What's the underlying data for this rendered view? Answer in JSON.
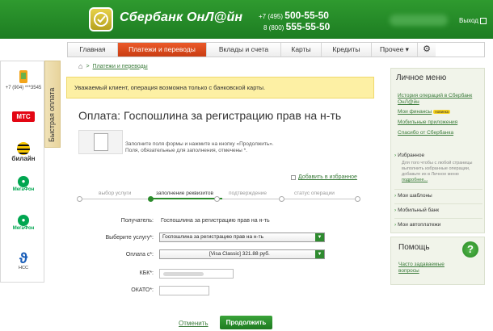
{
  "header": {
    "logo_text": "Сбербанк ОнЛ@йн",
    "phone1_prefix": "+7 (495)",
    "phone1_number": "500-55-50",
    "phone2_prefix": "8 (800)",
    "phone2_number": "555-55-50",
    "exit_label": "Выход"
  },
  "nav": {
    "items": [
      {
        "label": "Главная"
      },
      {
        "label": "Платежи и переводы"
      },
      {
        "label": "Вклады и счета"
      },
      {
        "label": "Карты"
      },
      {
        "label": "Кредиты"
      },
      {
        "label": "Прочее ▾"
      }
    ],
    "settings_icon": "gear-icon"
  },
  "quick_pay": {
    "tab_label": "Быстрая оплата",
    "operators": [
      {
        "name": "",
        "number": "+7 (904) ***3545"
      },
      {
        "name": "МТС"
      },
      {
        "name": "билайн"
      },
      {
        "name": "МегаФон"
      },
      {
        "name": "МегаФон"
      },
      {
        "name": "НСС"
      }
    ]
  },
  "breadcrumb": {
    "link": "Платежи и переводы"
  },
  "alert": "Уважаемый клиент, операция возможна только с банковской карты.",
  "page_title": "Оплата: Госпошлина за регистрацию прав на н-ть",
  "hint": {
    "line1": "Заполните поля формы и нажмите на кнопку «Продолжить».",
    "line2": "Поля, обязательные для заполнения, отмечены *."
  },
  "favorite_link": "Добавить в избранное",
  "steps": [
    {
      "label": "выбор услуги"
    },
    {
      "label": "заполнение реквизитов"
    },
    {
      "label": "подтверждение"
    },
    {
      "label": "статус операции"
    }
  ],
  "form": {
    "recipient_label": "Получатель:",
    "recipient_value": "Госпошлина за регистрацию прав на н-ть",
    "service_label": "Выберите услугу*:",
    "service_value": "Госпошлина за регистрацию прав на н-ть",
    "payfrom_label": "Оплата с*:",
    "payfrom_value": "[Visa Classic] 321.88 руб.",
    "kbk_label": "КБК*:",
    "okato_label": "ОКАТО*:"
  },
  "actions": {
    "cancel": "Отменить",
    "submit": "Продолжить"
  },
  "personal_menu": {
    "title": "Личное меню",
    "links": [
      "История операций в Сбербанк ОнЛ@йн",
      "Мои финансы",
      "Мобильные приложения",
      "Спасибо от Сбербанка"
    ],
    "badge": "новинка",
    "favorites": "Избранное",
    "favorites_note": "Для того чтобы с любой страницы выполнить избранные операции, добавьте их в Личное меню",
    "favorites_note_link": "подробнее...",
    "templates": "Мои шаблоны",
    "mobile_bank": "Мобильный банк",
    "autopay": "Мои автоплатежи"
  },
  "help": {
    "title": "Помощь",
    "link": "Часто задаваемые вопросы"
  },
  "colors": {
    "brand_green": "#1d7d22",
    "active_tab": "#d9481b",
    "alert_bg": "#fdf0a4"
  }
}
